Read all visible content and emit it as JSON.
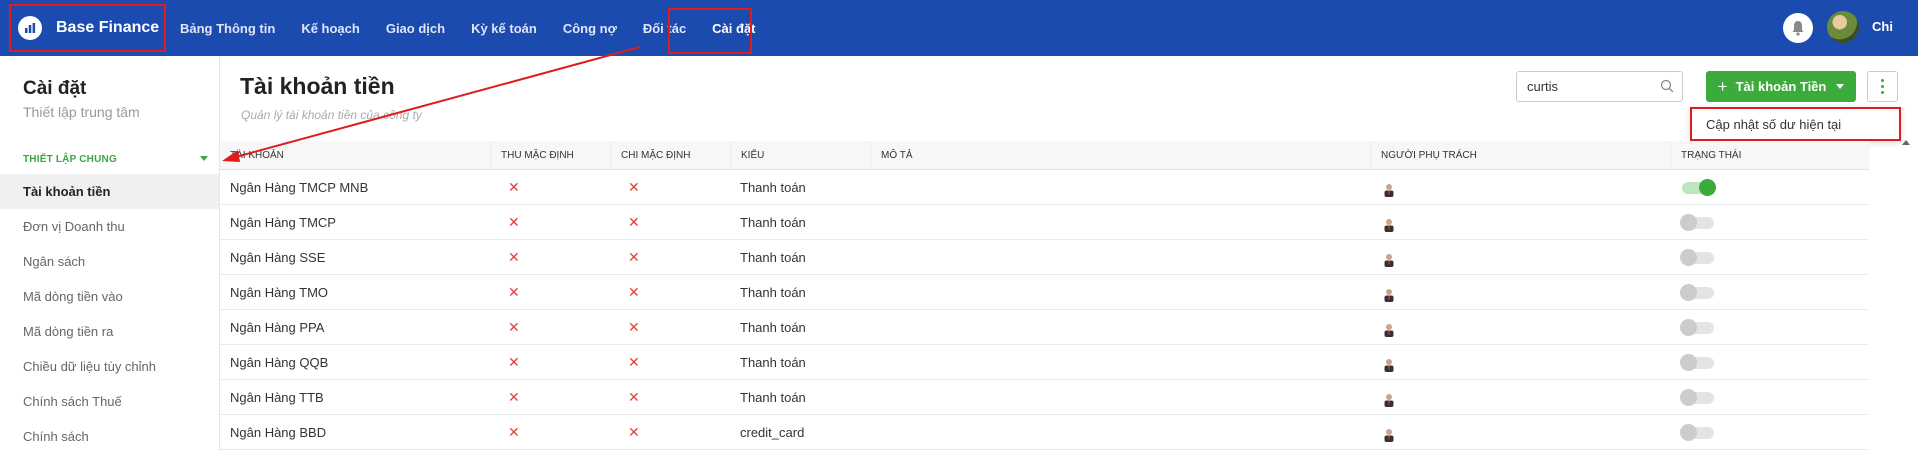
{
  "header": {
    "brand": "Base Finance",
    "nav": [
      "Bảng Thông tin",
      "Kế hoạch",
      "Giao dịch",
      "Kỳ kế toán",
      "Công nợ",
      "Đối tác",
      "Cài đặt"
    ],
    "active_nav_index": 6,
    "user_name": "Chi"
  },
  "sidebar": {
    "title": "Cài đặt",
    "subtitle": "Thiết lập trung tâm",
    "section": "THIẾT LẬP CHUNG",
    "items": [
      "Tài khoản tiền",
      "Đơn vị Doanh thu",
      "Ngân sách",
      "Mã dòng tiền vào",
      "Mã dòng tiền ra",
      "Chiều dữ liệu tùy chỉnh",
      "Chính sách Thuế",
      "Chính sách"
    ],
    "active_index": 0
  },
  "main": {
    "title": "Tài khoản tiền",
    "subtitle": "Quản lý tài khoản tiền của công ty",
    "search_value": "curtis",
    "add_button": "Tài khoản Tiền",
    "dropdown_item": "Cập nhật số dư hiện tại"
  },
  "table": {
    "columns": [
      "TÀI KHOẢN",
      "THU MẶC ĐỊNH",
      "CHI MẶC ĐỊNH",
      "KIỂU",
      "MÔ TẢ",
      "NGƯỜI PHỤ TRÁCH",
      "TRẠNG THÁI"
    ],
    "rows": [
      {
        "account": "Ngân Hàng TMCP MNB",
        "type": "Thanh toán",
        "active": true
      },
      {
        "account": "Ngân Hàng TMCP",
        "type": "Thanh toán",
        "active": false
      },
      {
        "account": "Ngân Hàng SSE",
        "type": "Thanh toán",
        "active": false
      },
      {
        "account": "Ngân Hàng TMO",
        "type": "Thanh toán",
        "active": false
      },
      {
        "account": "Ngân Hàng PPA",
        "type": "Thanh toán",
        "active": false
      },
      {
        "account": "Ngân Hàng QQB",
        "type": "Thanh toán",
        "active": false
      },
      {
        "account": "Ngân Hàng TTB",
        "type": "Thanh toán",
        "active": false
      },
      {
        "account": "Ngân Hàng BBD",
        "type": "credit_card",
        "active": false
      }
    ],
    "x_mark": "✕"
  },
  "colors": {
    "header_bg": "#1c4bb0",
    "accent_green": "#3bab3b",
    "highlight_red": "#e01b1b",
    "x_red": "#e0443a"
  }
}
